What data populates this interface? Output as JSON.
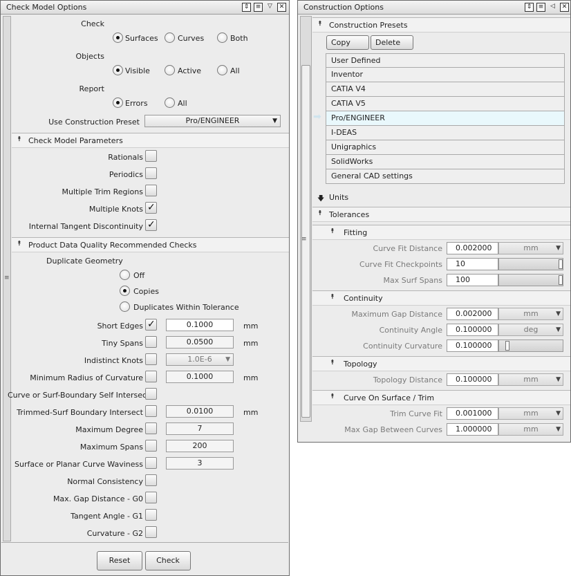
{
  "left": {
    "title": "Check Model Options",
    "check": {
      "label": "Check",
      "options": [
        "Surfaces",
        "Curves",
        "Both"
      ],
      "selected": 0
    },
    "objects": {
      "label": "Objects",
      "options": [
        "Visible",
        "Active",
        "All"
      ],
      "selected": 0
    },
    "report": {
      "label": "Report",
      "options": [
        "Errors",
        "All"
      ],
      "selected": 0
    },
    "preset": {
      "label": "Use Construction Preset",
      "value": "Pro/ENGINEER"
    },
    "params_section": "Check Model Parameters",
    "params": [
      {
        "label": "Rationals",
        "checked": false
      },
      {
        "label": "Periodics",
        "checked": false
      },
      {
        "label": "Multiple Trim Regions",
        "checked": false
      },
      {
        "label": "Multiple Knots",
        "checked": true
      },
      {
        "label": "Internal Tangent Discontinuity",
        "checked": true
      }
    ],
    "pdq_section": "Product Data Quality Recommended Checks",
    "dup_label": "Duplicate Geometry",
    "dup_options": [
      "Off",
      "Copies",
      "Duplicates Within Tolerance"
    ],
    "dup_selected": 1,
    "checks": [
      {
        "label": "Short Edges",
        "checked": true,
        "value": "0.1000",
        "unit": "mm"
      },
      {
        "label": "Tiny Spans",
        "checked": false,
        "value": "0.0500",
        "unit": "mm"
      },
      {
        "label": "Indistinct Knots",
        "checked": false,
        "value": "1.0E-6",
        "unit": ""
      },
      {
        "label": "Minimum Radius of Curvature",
        "checked": false,
        "value": "0.1000",
        "unit": "mm"
      },
      {
        "label": "Curve or Surf-Boundary Self Intersect",
        "checked": false,
        "value": "",
        "unit": ""
      },
      {
        "label": "Trimmed-Surf Boundary Intersect",
        "checked": false,
        "value": "0.0100",
        "unit": "mm"
      },
      {
        "label": "Maximum Degree",
        "checked": false,
        "value": "7",
        "unit": ""
      },
      {
        "label": "Maximum Spans",
        "checked": false,
        "value": "200",
        "unit": ""
      },
      {
        "label": "Surface or Planar Curve Waviness",
        "checked": false,
        "value": "3",
        "unit": ""
      },
      {
        "label": "Normal Consistency",
        "checked": false,
        "value": "",
        "unit": ""
      },
      {
        "label": "Max. Gap Distance - G0",
        "checked": false,
        "value": "",
        "unit": ""
      },
      {
        "label": "Tangent Angle - G1",
        "checked": false,
        "value": "",
        "unit": ""
      },
      {
        "label": "Curvature - G2",
        "checked": false,
        "value": "",
        "unit": ""
      }
    ],
    "reset_label": "Reset",
    "check_label": "Check"
  },
  "right": {
    "title": "Construction Options",
    "presets_section": "Construction Presets",
    "copy_label": "Copy",
    "delete_label": "Delete",
    "presets": [
      "User Defined",
      "Inventor",
      "CATIA V4",
      "CATIA V5",
      "Pro/ENGINEER",
      "I-DEAS",
      "Unigraphics",
      "SolidWorks",
      "General CAD settings"
    ],
    "selected_preset": 4,
    "units_section": "Units",
    "tolerances_section": "Tolerances",
    "fitting_section": "Fitting",
    "fitting": [
      {
        "label": "Curve Fit Distance",
        "value": "0.002000",
        "unit": "mm"
      },
      {
        "label": "Curve Fit Checkpoints",
        "value": "10",
        "slider": 1.0
      },
      {
        "label": "Max Surf Spans",
        "value": "100",
        "slider": 1.0
      }
    ],
    "continuity_section": "Continuity",
    "continuity": [
      {
        "label": "Maximum Gap Distance",
        "value": "0.002000",
        "unit": "mm"
      },
      {
        "label": "Continuity Angle",
        "value": "0.100000",
        "unit": "deg"
      },
      {
        "label": "Continuity Curvature",
        "value": "0.100000",
        "slider": 0.1
      }
    ],
    "topology_section": "Topology",
    "topology": [
      {
        "label": "Topology Distance",
        "value": "0.100000",
        "unit": "mm"
      }
    ],
    "cos_section": "Curve On Surface / Trim",
    "cos": [
      {
        "label": "Trim Curve Fit",
        "value": "0.001000",
        "unit": "mm"
      },
      {
        "label": "Max Gap Between Curves",
        "value": "1.000000",
        "unit": "mm"
      }
    ]
  }
}
